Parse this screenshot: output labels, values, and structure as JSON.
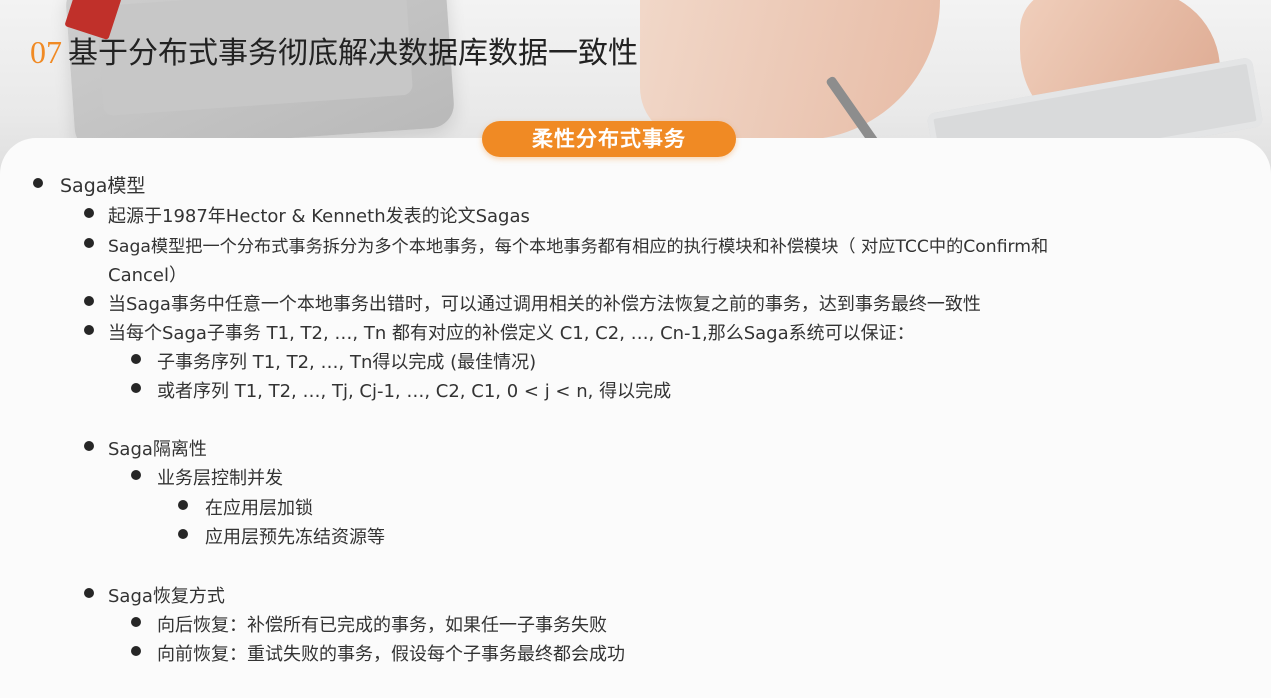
{
  "header": {
    "section_number": "07",
    "title": "基于分布式事务彻底解决数据库数据一致性"
  },
  "badge": "柔性分布式事务",
  "outline": {
    "saga_model": {
      "heading": "Saga模型",
      "origin": "起源于1987年Hector & Kenneth发表的论文Sagas",
      "split_line1": "Saga模型把一个分布式事务拆分为多个本地事务，每个本地事务都有相应的执行模块和补偿模块（ 对应TCC中的Confirm和",
      "split_line2": "Cancel）",
      "compensate": "当Saga事务中任意一个本地事务出错时，可以通过调用相关的补偿方法恢复之前的事务，达到事务最终一致性",
      "guarantee": "当每个Saga子事务 T1, T2, …, Tn 都有对应的补偿定义 C1, C2, …, Cn-1,那么Saga系统可以保证：",
      "case_best": "子事务序列 T1, T2, …, Tn得以完成 (最佳情况)",
      "case_rollback": "或者序列 T1, T2, …, Tj, Cj-1, …, C2, C1, 0 < j < n, 得以完成"
    },
    "saga_isolation": {
      "heading": "Saga隔离性",
      "business_layer": "业务层控制并发",
      "lock": "在应用层加锁",
      "freeze": "应用层预先冻结资源等"
    },
    "saga_recovery": {
      "heading": "Saga恢复方式",
      "backward": "向后恢复：补偿所有已完成的事务，如果任一子事务失败",
      "forward": "向前恢复：重试失败的事务，假设每个子事务最终都会成功"
    }
  },
  "colors": {
    "accent": "#f08a24",
    "text": "#333333",
    "bullet": "#262626"
  }
}
